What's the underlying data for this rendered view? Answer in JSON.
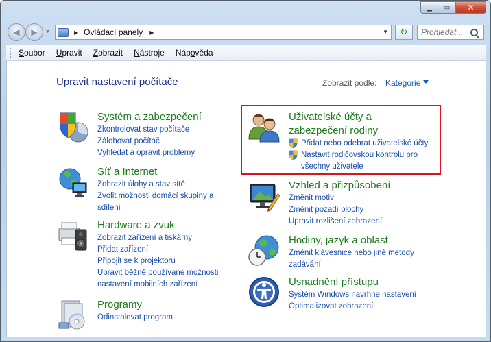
{
  "window": {
    "caption": {
      "minimize": "▁",
      "maximize": "▭",
      "close": "✕"
    }
  },
  "address": {
    "path": "Ovládací panely",
    "search_placeholder": "Prohledat ..."
  },
  "menu": {
    "items": [
      {
        "pre": "",
        "u": "S",
        "post": "oubor"
      },
      {
        "pre": "",
        "u": "U",
        "post": "pravit"
      },
      {
        "pre": "",
        "u": "Z",
        "post": "obrazit"
      },
      {
        "pre": "",
        "u": "N",
        "post": "ástroje"
      },
      {
        "pre": "Náp",
        "u": "o",
        "post": "věda"
      }
    ]
  },
  "main": {
    "title": "Upravit nastavení počítače",
    "view_by_label": "Zobrazit podle:",
    "view_by_value": "Kategorie",
    "categories": [
      {
        "title": "Systém a zabezpečení",
        "icon": "system-security-icon",
        "links": [
          "Zkontrolovat stav počítače",
          "Zálohovat počítač",
          "Vyhledat a opravit problémy"
        ]
      },
      {
        "title": "Síť a Internet",
        "icon": "network-internet-icon",
        "links": [
          "Zobrazit úlohy a stav sítě",
          "Zvolit možnosti domácí skupiny a",
          "sdílení"
        ]
      },
      {
        "title": "Hardware a zvuk",
        "icon": "hardware-sound-icon",
        "links": [
          "Zobrazit zařízení a tiskárny",
          "Přidat zařízení",
          "Připojit se k projektoru",
          "Upravit běžně používané možnosti",
          "nastavení mobilních zařízení"
        ]
      },
      {
        "title": "Programy",
        "icon": "programs-icon",
        "links": [
          "Odinstalovat program"
        ]
      },
      {
        "title_line1": "Uživatelské účty a",
        "title_line2": "zabezpečení rodiny",
        "icon": "user-accounts-icon",
        "links": [
          "Přidat nebo odebrat uživatelské účty",
          "Nastavit rodičovskou kontrolu pro",
          "všechny uživatele"
        ]
      },
      {
        "title": "Vzhled a přizpůsobení",
        "icon": "appearance-icon",
        "links": [
          "Změnit motiv",
          "Změnit pozadí plochy",
          "Upravit rozlišení zobrazení"
        ]
      },
      {
        "title": "Hodiny, jazyk a oblast",
        "icon": "clock-language-region-icon",
        "links": [
          "Změnit klávesnice nebo jiné metody",
          "zadávání"
        ]
      },
      {
        "title": "Usnadnění přístupu",
        "icon": "ease-of-access-icon",
        "links": [
          "Systém Windows navrhne nastavení",
          "Optimalizovat zobrazení"
        ]
      }
    ]
  },
  "colors": {
    "category_title": "#1e7d1e",
    "link": "#1a4fae",
    "page_title": "#1e3287",
    "highlight": "#d8151c"
  }
}
